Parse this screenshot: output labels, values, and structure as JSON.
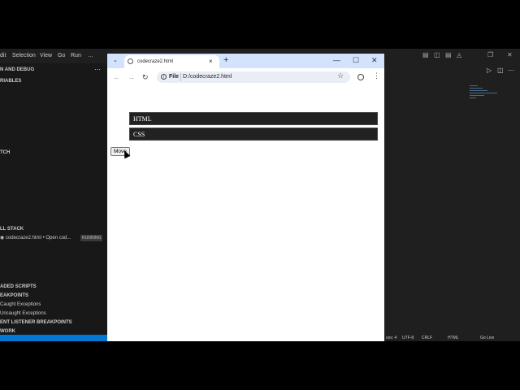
{
  "vscode": {
    "menu": [
      "dit",
      "Selection",
      "View",
      "Go",
      "Run",
      "…"
    ],
    "sidebar": {
      "run_and_debug": "N AND DEBUG",
      "variables": "RIABLES",
      "watch": "TCH",
      "call_stack": "LL STACK",
      "session_label": "codecraze2.html • Open cod...",
      "session_status": "RUNNING",
      "loaded_scripts": "ADED SCRIPTS",
      "breakpoints": "EAKPOINTS",
      "caught_exceptions": "Caught Exceptions",
      "uncaught_exceptions": "Uncaught Exceptions",
      "event_listener_breakpoints": "ENT LISTENER BREAKPOINTS",
      "network": "WORK"
    },
    "status": {
      "spaces": "ces: 4",
      "encoding": "UTF-8",
      "eol": "CRLF",
      "language": "HTML",
      "golive": "Go Live"
    }
  },
  "chrome": {
    "tab_title": "codecraze2.html",
    "scheme_label": "File",
    "url": "D:/codecraze2.html",
    "new_tab": "+",
    "tab_close": "×"
  },
  "page": {
    "items": [
      "HTML",
      "CSS"
    ],
    "move_button": "Move"
  }
}
